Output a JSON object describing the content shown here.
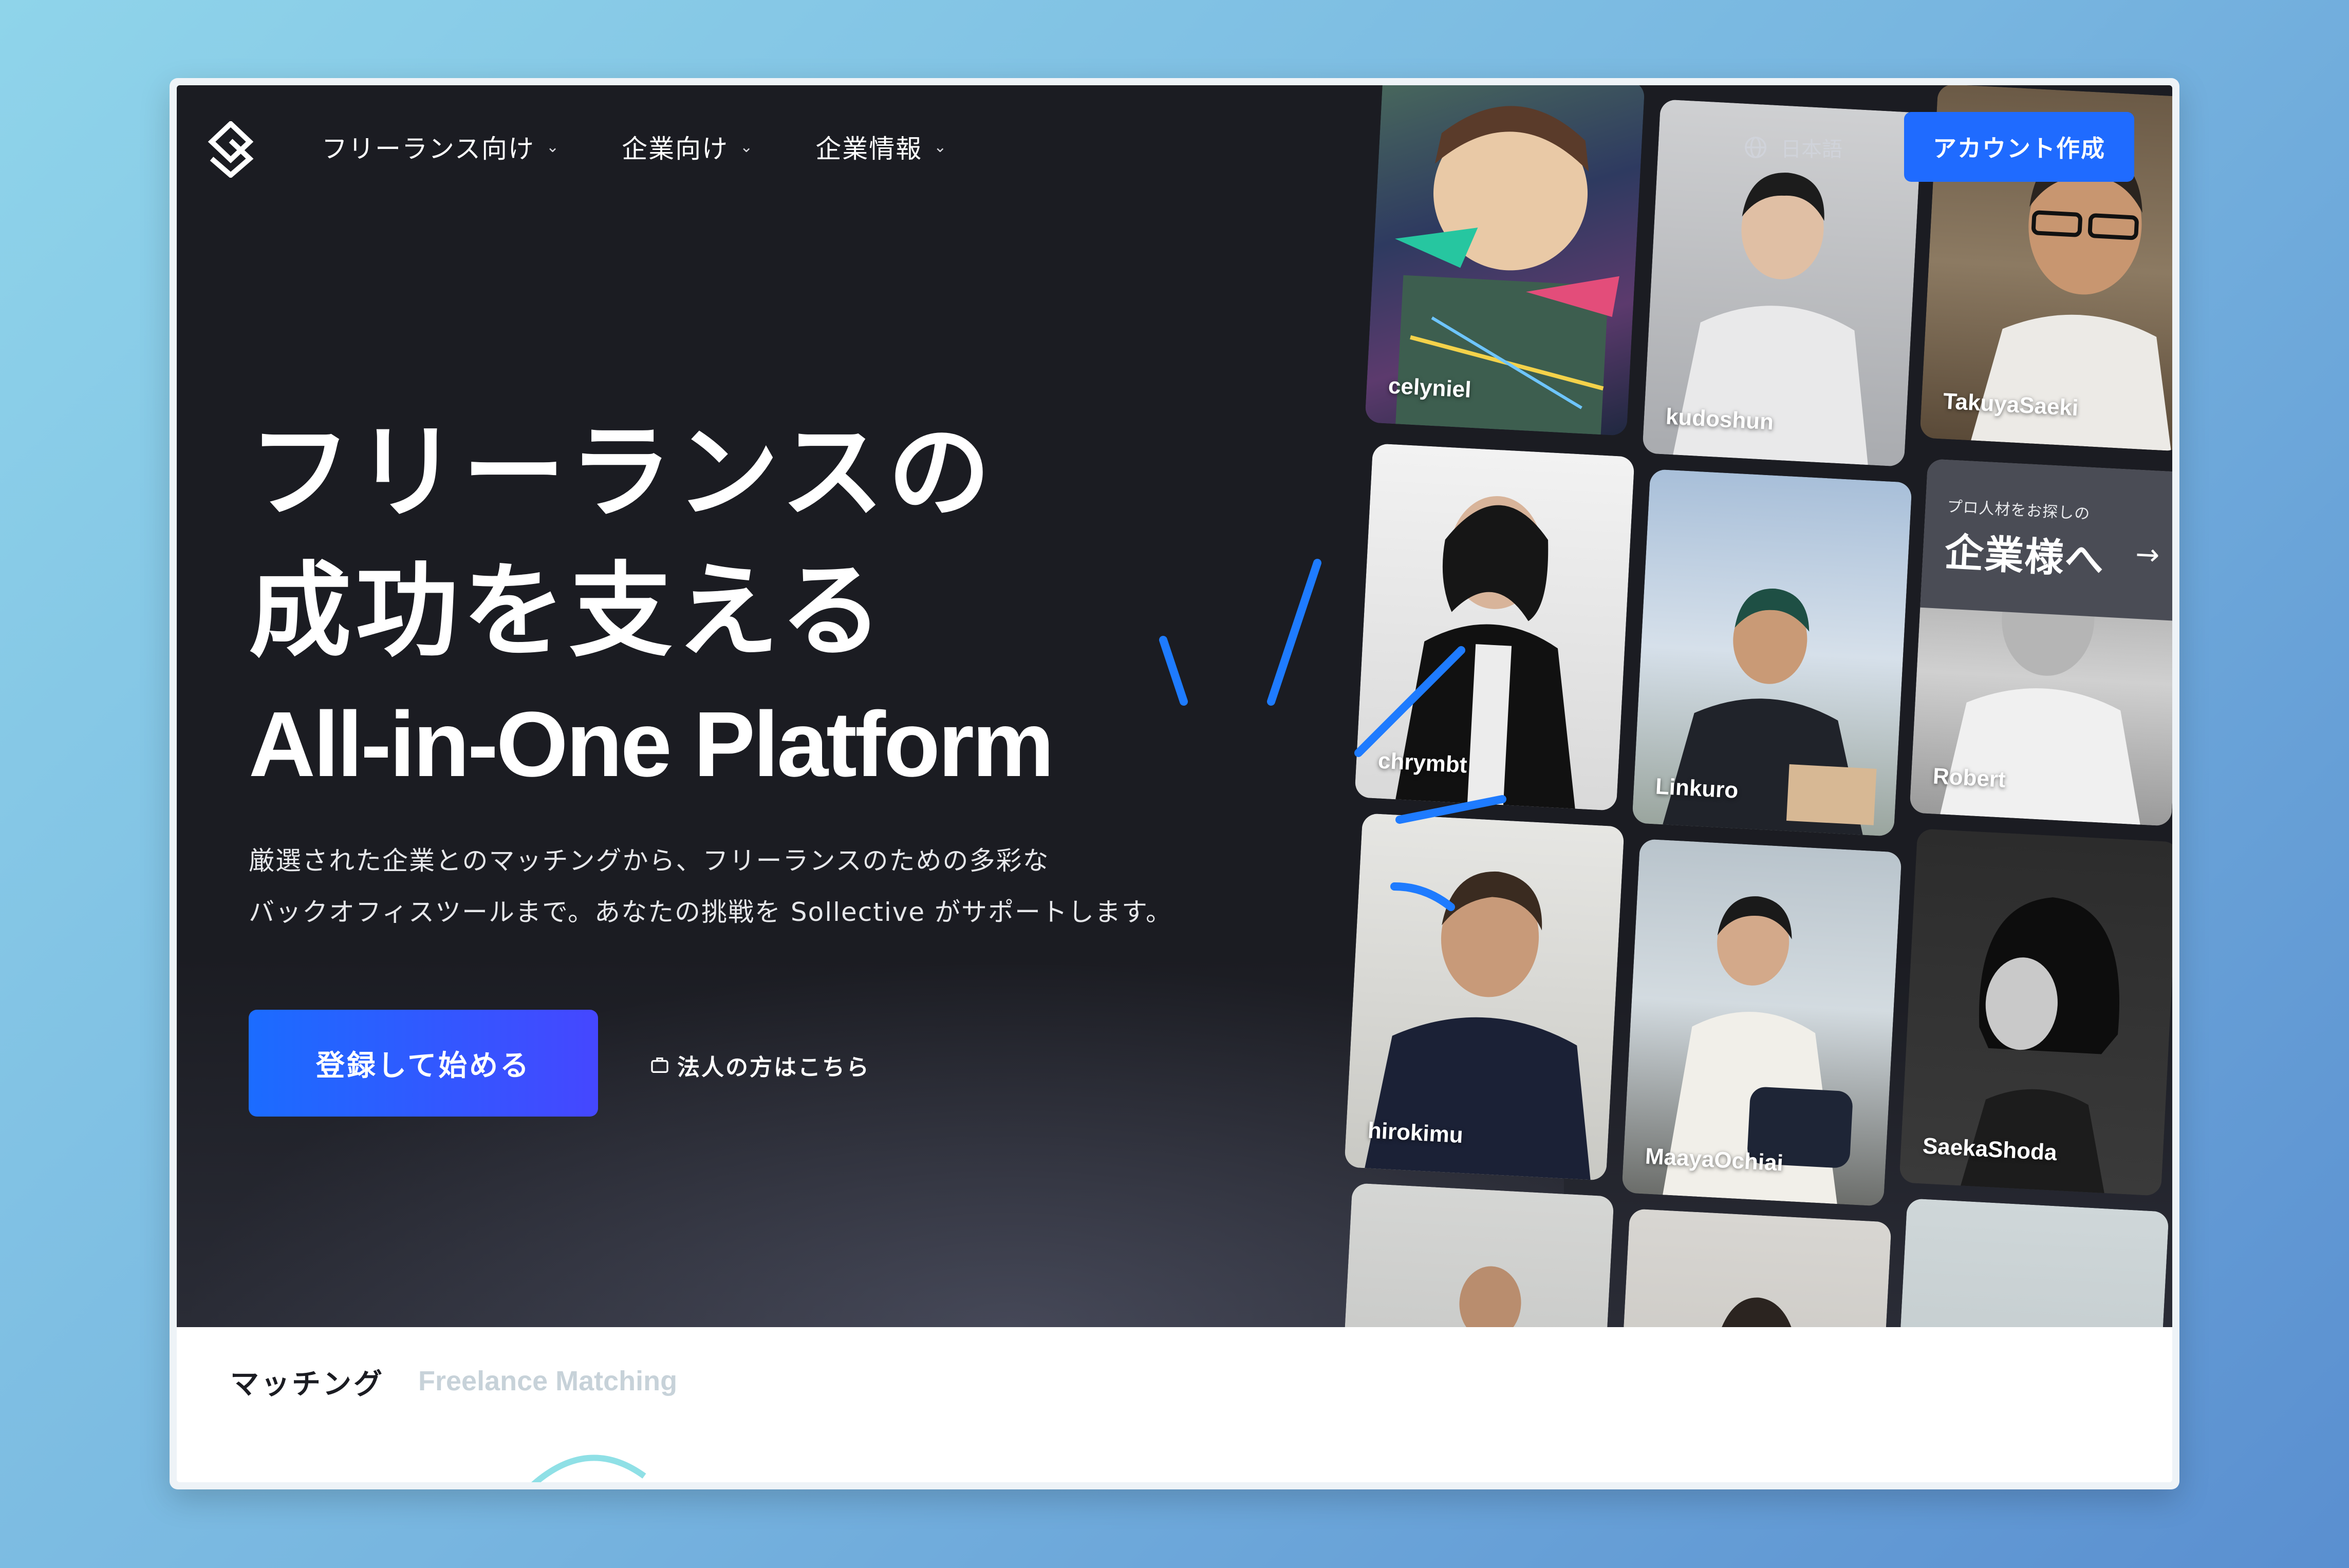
{
  "nav": {
    "items": [
      {
        "label": "フリーランス向け"
      },
      {
        "label": "企業向け"
      },
      {
        "label": "企業情報"
      }
    ],
    "language": "日本語",
    "cta": "アカウント作成"
  },
  "hero": {
    "headline_line1": "フリーランスの",
    "headline_line2": "成功を支える",
    "headline_en": "All-in-One Platform",
    "description_line1": "厳選された企業とのマッチングから、フリーランスのための多彩な",
    "description_line2": "バックオフィスツールまで。あなたの挑戦を Sollective がサポートします。",
    "primary_button": "登録して始める",
    "corporate_link": "法人の方はこちら"
  },
  "cards": [
    {
      "name": "celyniel"
    },
    {
      "name": "kudoshun"
    },
    {
      "name": "TakuyaSaeki"
    },
    {
      "name": "chrymbt"
    },
    {
      "name": "Linkuro"
    },
    {
      "name": "Robert"
    },
    {
      "name": "hirokimu"
    },
    {
      "name": "MaayaOchiai"
    },
    {
      "name": "SaekaShoda"
    }
  ],
  "company_card": {
    "sub": "プロ人材をお探しの",
    "title": "企業様へ",
    "arrow": "→"
  },
  "section": {
    "title": "マッチング",
    "subtitle": "Freelance Matching"
  },
  "colors": {
    "hero_bg": "#1b1c22",
    "accent": "#1f6bff",
    "stroke": "#1e7bff"
  }
}
